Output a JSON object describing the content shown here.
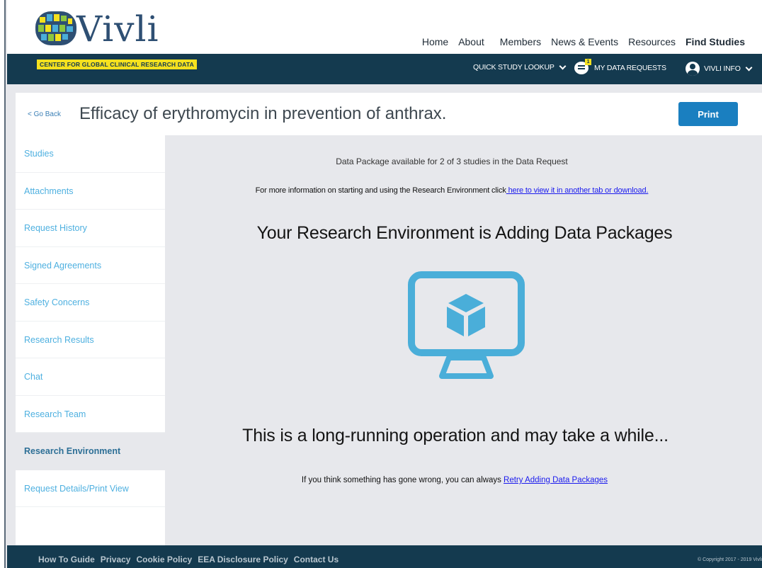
{
  "header": {
    "logo_text": "Vivli",
    "tagline": "CENTER FOR GLOBAL CLINICAL RESEARCH DATA",
    "nav": [
      "Home",
      "About",
      "Members",
      "News & Events",
      "Resources",
      "Find Studies"
    ],
    "active_nav": "Find Studies",
    "quick_lookup": "QUICK STUDY LOOKUP",
    "data_requests": "MY DATA REQUESTS",
    "data_requests_badge": "1",
    "user_menu": "VIVLI INFO"
  },
  "title_bar": {
    "go_back": "< Go Back",
    "title": "Efficacy of erythromycin in prevention of anthrax.",
    "print": "Print"
  },
  "sidebar": {
    "items": [
      "Studies",
      "Attachments",
      "Request History",
      "Signed Agreements",
      "Safety Concerns",
      "Research Results",
      "Chat",
      "Research Team",
      "Research Environment",
      "Request Details/Print View"
    ],
    "active": "Research Environment"
  },
  "main": {
    "availability": "Data Package available for 2 of 3 studies in the Data Request",
    "info_text": "For more information on starting and using the Research Environment click",
    "info_link": " here to view it in another tab or download.",
    "heading": "Your Research Environment is Adding Data Packages",
    "subheading": "This is a long-running operation and may take a while...",
    "retry_text": "If you think something has gone wrong, you can always ",
    "retry_link": "Retry Adding Data Packages",
    "icon": "monitor-cube-icon"
  },
  "footer": {
    "links": [
      "How To Guide",
      "Privacy",
      "Cookie Policy",
      "EEA Disclosure Policy",
      "Contact Us"
    ],
    "copyright": "© Copyright 2017 - 2019 Vivli"
  },
  "colors": {
    "navy": "#143a4f",
    "accent_blue": "#1a7fc0",
    "icon_blue": "#4aaed9",
    "tagline_yellow": "#f5e11e",
    "sidebar_link": "#4eb0e0"
  }
}
